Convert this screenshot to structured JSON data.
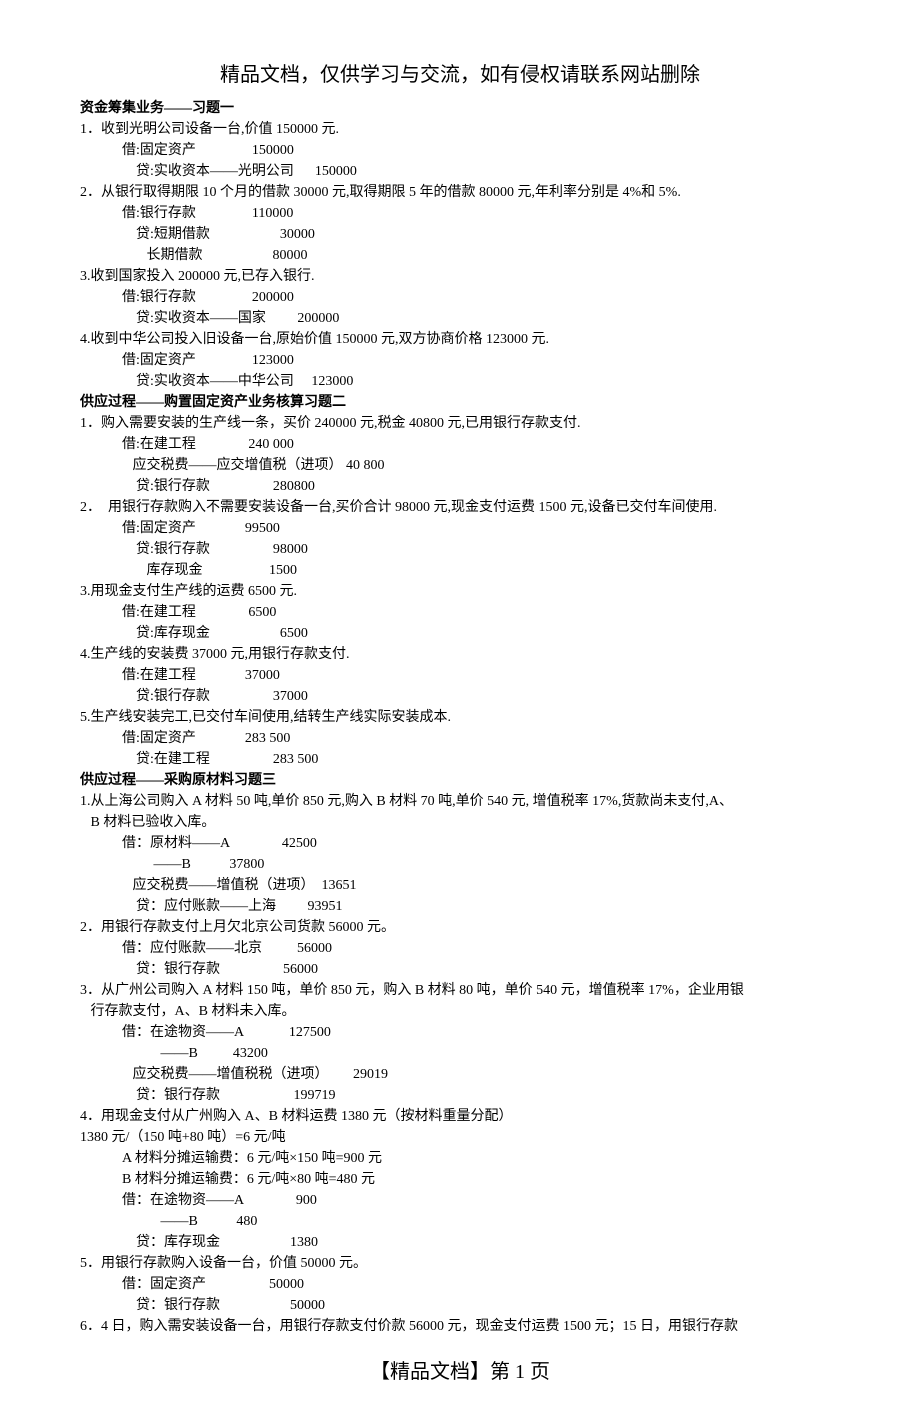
{
  "header": "精品文档，仅供学习与交流，如有侵权请联系网站删除",
  "footer": "【精品文档】第 1 页",
  "sections": [
    {
      "title": "资金筹集业务——习题一",
      "items": [
        {
          "desc": "1．收到光明公司设备一台,价值 150000 元.",
          "lines": [
            "借:固定资产                150000",
            "    贷:实收资本——光明公司      150000"
          ]
        },
        {
          "desc": "2．从银行取得期限 10 个月的借款 30000 元,取得期限 5 年的借款 80000 元,年利率分别是 4%和 5%.",
          "lines": [
            "借:银行存款                110000",
            "    贷:短期借款                    30000",
            "       长期借款                    80000"
          ]
        },
        {
          "desc": "3.收到国家投入 200000 元,已存入银行.",
          "lines": [
            "借:银行存款                200000",
            "    贷:实收资本——国家         200000"
          ]
        },
        {
          "desc": "4.收到中华公司投入旧设备一台,原始价值 150000 元,双方协商价格 123000 元.",
          "lines": [
            "借:固定资产                123000",
            "    贷:实收资本——中华公司     123000"
          ]
        }
      ]
    },
    {
      "title": "供应过程——购置固定资产业务核算习题二",
      "items": [
        {
          "desc": "1．购入需要安装的生产线一条，买价 240000 元,税金 40800 元,已用银行存款支付.",
          "lines": [
            "借:在建工程               240 000",
            "   应交税费——应交增值税（进项） 40 800",
            "    贷:银行存款                  280800"
          ]
        },
        {
          "desc": "2．  用银行存款购入不需要安装设备一台,买价合计 98000 元,现金支付运费 1500 元,设备已交付车间使用.",
          "lines": [
            "借:固定资产              99500",
            "    贷:银行存款                  98000",
            "       库存现金                   1500"
          ]
        },
        {
          "desc": "3.用现金支付生产线的运费 6500 元.",
          "lines": [
            "借:在建工程               6500",
            "    贷:库存现金                    6500"
          ]
        },
        {
          "desc": "4.生产线的安装费 37000 元,用银行存款支付.",
          "lines": [
            "借:在建工程              37000",
            "    贷:银行存款                  37000"
          ]
        },
        {
          "desc": "5.生产线安装完工,已交付车间使用,结转生产线实际安装成本.",
          "lines": [
            "借:固定资产              283 500",
            "    贷:在建工程                  283 500"
          ]
        }
      ]
    },
    {
      "title": "供应过程——采购原材料习题三",
      "items": [
        {
          "desc": "1.从上海公司购入 A 材料 50 吨,单价 850 元,购入 B 材料 70 吨,单价 540 元, 增值税率 17%,货款尚未支付,A、",
          "desc2": "   B 材料已验收入库。",
          "lines": [
            "借：原材料——A               42500",
            "         ——B           37800",
            "   应交税费——增值税（进项）  13651",
            "    贷：应付账款——上海         93951"
          ]
        },
        {
          "desc": "2．用银行存款支付上月欠北京公司货款 56000 元。",
          "lines": [
            "借：应付账款——北京          56000",
            "    贷：银行存款                  56000"
          ]
        },
        {
          "desc": "3．从广州公司购入 A 材料 150 吨，单价 850 元，购入 B 材料 80 吨，单价 540 元，增值税率 17%，企业用银",
          "desc2": "   行存款支付，A、B 材料未入库。",
          "lines": [
            "借：在途物资——A             127500",
            "           ——B          43200",
            "   应交税费——增值税税（进项）       29019",
            "    贷：银行存款                     199719"
          ]
        },
        {
          "desc": "4．用现金支付从广州购入 A、B 材料运费 1380 元（按材料重量分配）",
          "extra": "1380 元/（150 吨+80 吨）=6 元/吨",
          "lines": [
            "A 材料分摊运输费：6 元/吨×150 吨=900 元",
            "B 材料分摊运输费：6 元/吨×80 吨=480 元",
            "借：在途物资——A               900",
            "           ——B           480",
            "    贷：库存现金                    1380"
          ]
        },
        {
          "desc": "5．用银行存款购入设备一台，价值 50000 元。",
          "lines": [
            "借：固定资产                  50000",
            "    贷：银行存款                    50000"
          ]
        },
        {
          "desc": "6．4 日，购入需安装设备一台，用银行存款支付价款 56000 元，现金支付运费 1500 元；15 日，用银行存款",
          "lines": []
        }
      ]
    }
  ]
}
